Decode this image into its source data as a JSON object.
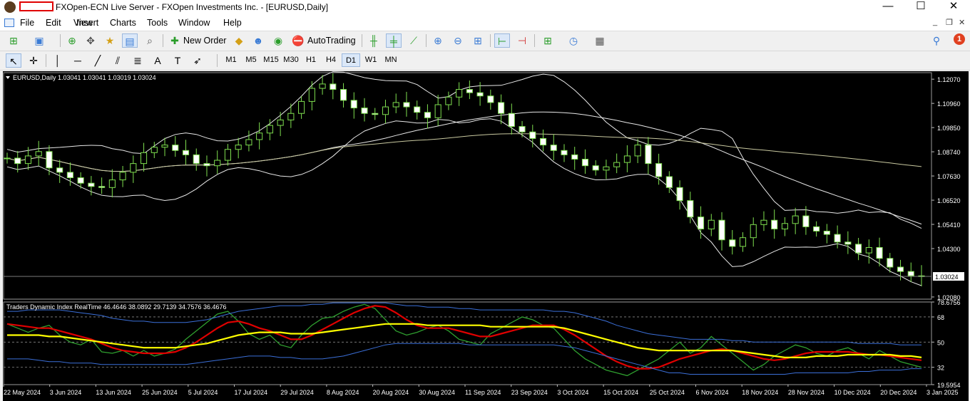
{
  "window": {
    "title": "FXOpen-ECN Live Server - FXOpen Investments Inc. - [EURUSD,Daily]",
    "controls": {
      "minimize": "—",
      "maximize": "☐",
      "close": "✕"
    }
  },
  "menu": {
    "items": [
      "File",
      "Edit",
      "View",
      "Insert",
      "Charts",
      "Tools",
      "Window",
      "Help"
    ],
    "mdi": {
      "minimize": "_",
      "restore": "❐",
      "close": "✕"
    }
  },
  "toolbar": {
    "new_order": "New Order",
    "autotrading": "AutoTrading",
    "notification_count": "1"
  },
  "drawing_toolbar": {
    "text_tool": "A",
    "label_tool": "T"
  },
  "timeframes": {
    "items": [
      "M1",
      "M5",
      "M15",
      "M30",
      "H1",
      "H4",
      "D1",
      "W1",
      "MN"
    ],
    "active": "D1"
  },
  "chart_data": [
    {
      "type": "candlestick",
      "title": "EURUSD,Daily  1.03041 1.03041 1.03019 1.03024",
      "symbol": "EURUSD",
      "timeframe": "Daily",
      "ohlc": [
        1.03041,
        1.03041,
        1.03019,
        1.03024
      ],
      "current_price": "1.03024",
      "y_ticks": [
        "1.12070",
        "1.10960",
        "1.09850",
        "1.08740",
        "1.07630",
        "1.06520",
        "1.05410",
        "1.04300",
        "1.03024",
        "1.02080"
      ],
      "ylim": [
        1.0198,
        1.1237
      ],
      "colors": {
        "background": "#000000",
        "bull_candle": "#000000",
        "bull_outline": "#7fdf4f",
        "bear_candle": "#ffffff",
        "wick": "#7fdf4f",
        "bands": "#ffffff",
        "ma_long": "#c9c9a0"
      },
      "close_series": [
        1.0845,
        1.082,
        1.0855,
        1.0875,
        1.08,
        1.078,
        1.0755,
        1.073,
        1.0715,
        1.071,
        1.0745,
        1.078,
        1.082,
        1.087,
        1.0895,
        1.0905,
        1.088,
        1.086,
        1.082,
        1.081,
        1.0835,
        1.0885,
        1.0905,
        1.093,
        1.096,
        1.0995,
        1.102,
        1.105,
        1.1105,
        1.1165,
        1.1185,
        1.116,
        1.111,
        1.1075,
        1.105,
        1.1045,
        1.108,
        1.11,
        1.108,
        1.1055,
        1.103,
        1.109,
        1.1125,
        1.116,
        1.1145,
        1.113,
        1.11,
        1.105,
        1.099,
        1.0965,
        1.0935,
        1.0905,
        1.088,
        1.086,
        1.084,
        1.081,
        1.079,
        1.0805,
        1.0825,
        1.0855,
        1.0905,
        1.082,
        1.076,
        1.071,
        1.065,
        1.0575,
        1.052,
        1.056,
        1.047,
        1.044,
        1.048,
        1.054,
        1.056,
        1.052,
        1.0545,
        1.058,
        1.053,
        1.051,
        1.0495,
        1.046,
        1.045,
        1.041,
        1.0435,
        1.0385,
        1.0345,
        1.0325,
        1.0305,
        1.0302
      ],
      "x_labels": [
        "22 May 2024",
        "3 Jun 2024",
        "13 Jun 2024",
        "25 Jun 2024",
        "5 Jul 2024",
        "17 Jul 2024",
        "29 Jul 2024",
        "8 Aug 2024",
        "20 Aug 2024",
        "30 Aug 2024",
        "11 Sep 2024",
        "23 Sep 2024",
        "3 Oct 2024",
        "15 Oct 2024",
        "25 Oct 2024",
        "6 Nov 2024",
        "18 Nov 2024",
        "28 Nov 2024",
        "10 Dec 2024",
        "20 Dec 2024",
        "3 Jan 2025"
      ]
    },
    {
      "type": "line",
      "title": "Traders Dynamic Index RealTime 46.4646 38.0892 29.7139 34.7576 36.4676",
      "indicator": "Traders Dynamic Index RealTime",
      "values_shown": [
        46.4646,
        38.0892,
        29.7139,
        34.7576,
        36.4676
      ],
      "ylim": [
        19.5954,
        78.6756
      ],
      "y_ticks": [
        "78.6756",
        "68",
        "50",
        "32",
        "19.5954"
      ],
      "levels": [
        68,
        50,
        32
      ],
      "series": [
        {
          "color": "#2fa02f",
          "values": [
            63,
            60,
            57,
            60,
            62,
            55,
            50,
            48,
            52,
            43,
            42,
            44,
            40,
            44,
            40,
            42,
            45,
            52,
            58,
            64,
            70,
            72,
            65,
            56,
            52,
            55,
            48,
            46,
            55,
            62,
            67,
            68,
            72,
            75,
            77,
            74,
            66,
            58,
            55,
            57,
            60,
            62,
            58,
            52,
            50,
            48,
            56,
            60,
            64,
            68,
            66,
            62,
            60,
            52,
            44,
            38,
            34,
            30,
            28,
            26,
            30,
            34,
            38,
            44,
            50,
            42,
            46,
            54,
            48,
            42,
            36,
            30,
            34,
            40,
            44,
            48,
            46,
            42,
            40,
            44,
            46,
            42,
            38,
            44,
            40,
            36,
            34,
            32
          ]
        },
        {
          "color": "#e00000",
          "values": [
            63,
            62,
            61,
            60,
            60,
            58,
            56,
            54,
            52,
            49,
            46,
            44,
            43,
            42,
            42,
            42,
            43,
            46,
            50,
            55,
            60,
            64,
            65,
            63,
            60,
            58,
            55,
            52,
            52,
            55,
            59,
            63,
            67,
            71,
            74,
            76,
            75,
            71,
            66,
            62,
            60,
            60,
            60,
            58,
            56,
            54,
            54,
            56,
            58,
            60,
            62,
            62,
            62,
            59,
            55,
            50,
            45,
            40,
            36,
            33,
            31,
            31,
            32,
            35,
            38,
            40,
            42,
            44,
            45,
            44,
            42,
            40,
            38,
            37,
            38,
            40,
            42,
            43,
            43,
            43,
            43,
            42,
            41,
            41,
            40,
            39,
            38,
            37
          ]
        },
        {
          "color": "#ffff00",
          "values": [
            55,
            55,
            55,
            55,
            54,
            54,
            53,
            52,
            51,
            50,
            49,
            48,
            47,
            46,
            46,
            46,
            46,
            47,
            48,
            49,
            51,
            53,
            55,
            56,
            57,
            57,
            57,
            56,
            56,
            56,
            57,
            58,
            59,
            60,
            61,
            62,
            63,
            63,
            63,
            63,
            62,
            62,
            62,
            62,
            62,
            62,
            61,
            61,
            61,
            61,
            61,
            61,
            61,
            60,
            58,
            56,
            54,
            52,
            50,
            48,
            46,
            45,
            44,
            44,
            44,
            44,
            44,
            44,
            44,
            44,
            43,
            42,
            41,
            40,
            39,
            39,
            39,
            40,
            40,
            40,
            41,
            41,
            41,
            41,
            41,
            40,
            40,
            39
          ]
        },
        {
          "color": "#3b6fd8",
          "values": [
            72,
            72,
            73,
            73,
            73,
            73,
            72,
            71,
            70,
            69,
            67,
            66,
            65,
            65,
            64,
            64,
            64,
            64,
            65,
            66,
            68,
            70,
            72,
            73,
            74,
            75,
            76,
            76,
            76,
            77,
            77,
            78,
            78,
            78,
            78,
            78,
            78,
            77,
            76,
            76,
            75,
            75,
            75,
            74,
            74,
            73,
            73,
            73,
            73,
            73,
            73,
            73,
            72,
            72,
            71,
            69,
            67,
            65,
            62,
            60,
            58,
            56,
            55,
            54,
            53,
            52,
            52,
            52,
            52,
            51,
            51,
            50,
            50,
            50,
            50,
            50,
            50,
            50,
            50,
            50,
            50,
            49,
            49,
            49,
            49,
            48,
            48,
            48
          ]
        },
        {
          "color": "#3b6fd8",
          "values": [
            38,
            38,
            38,
            37,
            36,
            36,
            35,
            35,
            35,
            34,
            34,
            34,
            34,
            34,
            34,
            34,
            34,
            34,
            35,
            36,
            37,
            38,
            39,
            40,
            40,
            40,
            39,
            39,
            38,
            38,
            38,
            39,
            40,
            42,
            44,
            46,
            48,
            49,
            49,
            49,
            49,
            49,
            49,
            49,
            48,
            48,
            48,
            48,
            48,
            48,
            48,
            48,
            48,
            47,
            46,
            44,
            42,
            40,
            38,
            36,
            34,
            32,
            30,
            28,
            28,
            27,
            27,
            27,
            27,
            27,
            27,
            27,
            27,
            27,
            27,
            28,
            28,
            28,
            28,
            28,
            28,
            29,
            29,
            30,
            30,
            30,
            31,
            31
          ]
        }
      ]
    }
  ]
}
